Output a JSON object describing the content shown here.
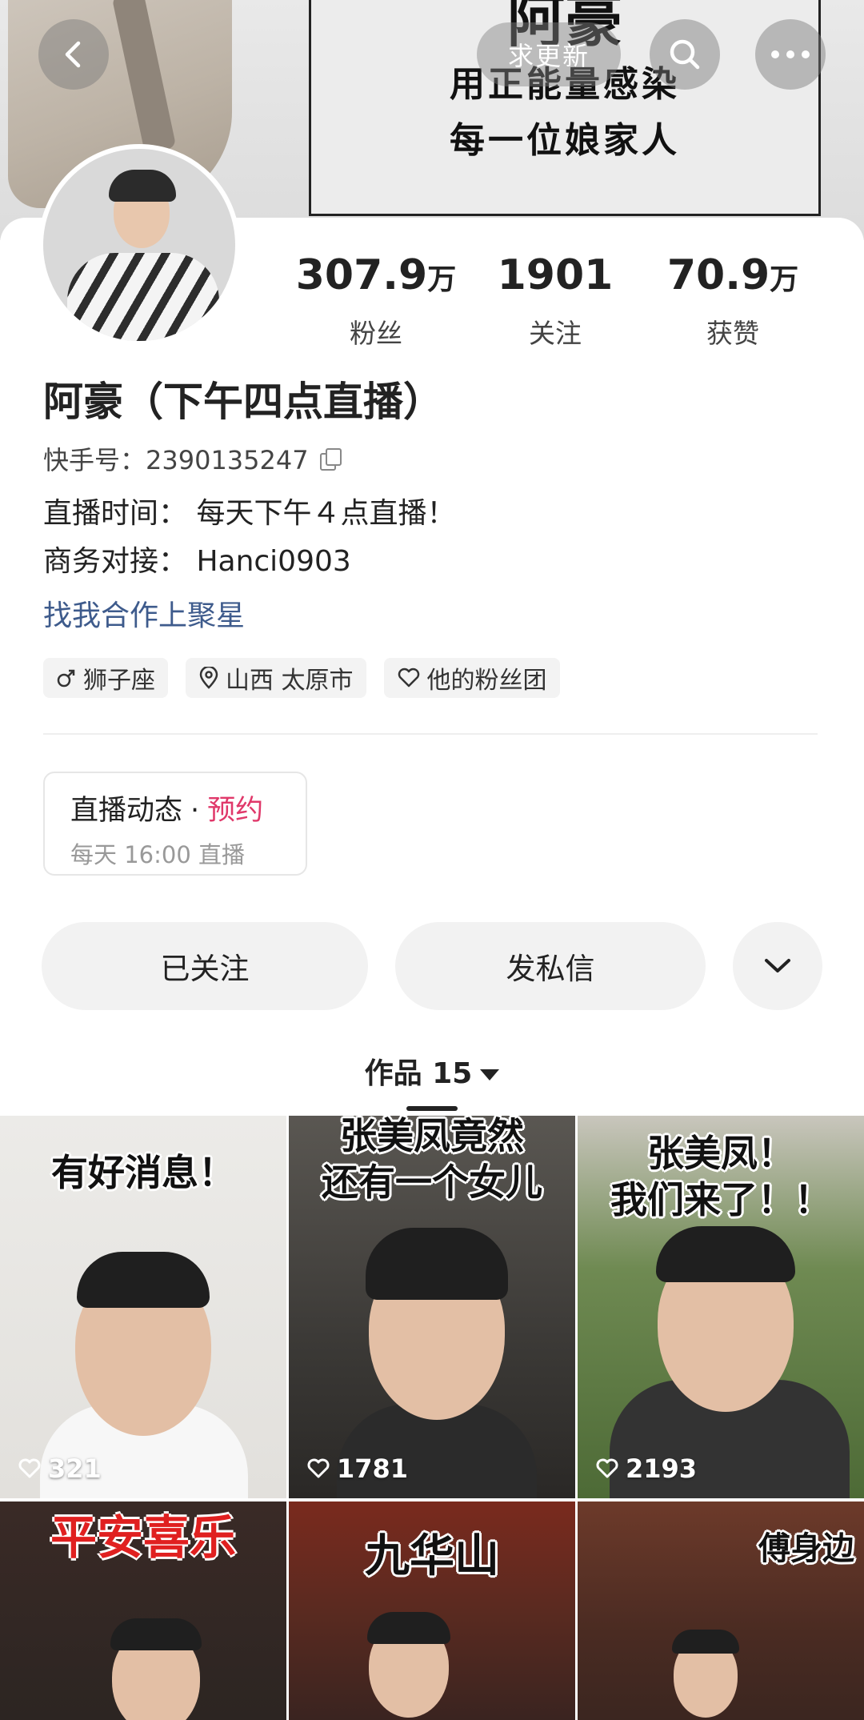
{
  "banner": {
    "board_title": "阿豪",
    "board_line1": "用正能量感染",
    "board_line2": "每一位娘家人",
    "update_label": "求更新"
  },
  "profile": {
    "stats": [
      {
        "num": "307.9",
        "unit": "万",
        "label": "粉丝"
      },
      {
        "num": "1901",
        "unit": "",
        "label": "关注"
      },
      {
        "num": "70.9",
        "unit": "万",
        "label": "获赞"
      }
    ],
    "name": "阿豪（下午四点直播）",
    "kuaishou_id": "快手号：2390135247",
    "bio_line1": "直播时间：  每天下午４点直播！",
    "bio_line2": "商务对接：  Hanci0903",
    "collab_link": "找我合作上聚星",
    "tags": [
      "狮子座",
      "山西 太原市",
      "他的粉丝团"
    ]
  },
  "live": {
    "title": "直播动态",
    "dot": "·",
    "reserve": "预约",
    "schedule": "每天 16:00 直播"
  },
  "actions": {
    "follow_label": "已关注",
    "message_label": "发私信"
  },
  "works_tab": {
    "label": "作品 15"
  },
  "videos": [
    {
      "caption": "有好消息！",
      "likes": "321"
    },
    {
      "caption": "张美凤竟然\n还有一个女儿",
      "likes": "1781"
    },
    {
      "caption": "张美凤！\n我们来了！！",
      "likes": "2193"
    },
    {
      "caption": "平安喜乐",
      "likes": ""
    },
    {
      "caption": "九华山",
      "likes": ""
    },
    {
      "caption": "傅身边",
      "likes": ""
    }
  ],
  "colors": {
    "accent_pink": "#e0386a",
    "link_blue": "#3e5b8c"
  },
  "icons": [
    "back-icon",
    "search-icon",
    "more-icon",
    "copy-icon",
    "male-icon",
    "location-icon",
    "heart-icon",
    "chevron-down-icon"
  ]
}
